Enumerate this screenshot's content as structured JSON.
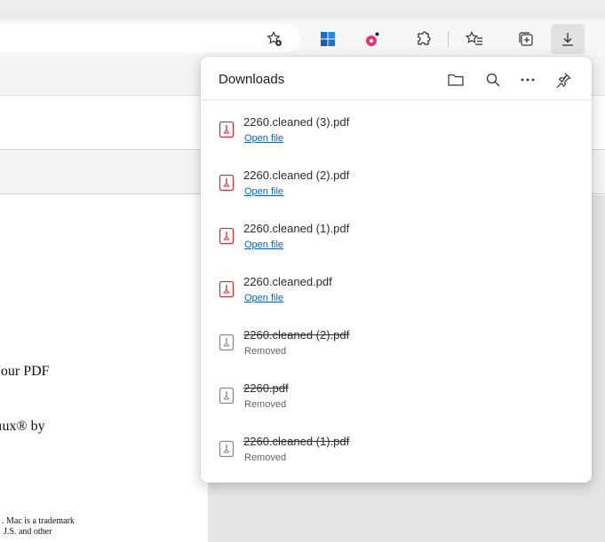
{
  "downloads_panel": {
    "title": "Downloads",
    "header_icons": [
      "folder-icon",
      "search-icon",
      "more-icon",
      "pin-icon"
    ],
    "items": [
      {
        "name": "2260.cleaned (3).pdf",
        "action": "Open file",
        "removed": false
      },
      {
        "name": "2260.cleaned (2).pdf",
        "action": "Open file",
        "removed": false
      },
      {
        "name": "2260.cleaned (1).pdf",
        "action": "Open file",
        "removed": false
      },
      {
        "name": "2260.cleaned.pdf",
        "action": "Open file",
        "removed": false
      },
      {
        "name": "2260.cleaned (2).pdf",
        "status": "Removed",
        "removed": true
      },
      {
        "name": "2260.pdf",
        "status": "Removed",
        "removed": true
      },
      {
        "name": "2260.cleaned (1).pdf",
        "status": "Removed",
        "removed": true
      }
    ]
  },
  "toolbar": {
    "icons": [
      "favorite-add-icon",
      "app-tile-icon",
      "extension-color-icon",
      "extensions-icon",
      "favorites-icon",
      "collections-icon",
      "downloads-icon"
    ]
  },
  "pdf_page": {
    "line1": "'our PDF",
    "line2": "ıux® by",
    "line3": ". Mac is a trademark",
    "line4": "J.S. and other"
  },
  "colors": {
    "accent_link": "#0f62b8",
    "pdf_icon_red": "#d13438",
    "removed_icon_gray": "#8a8a8a",
    "tile_blue": "#1f6fc5",
    "extension_pink": "#e8317a"
  }
}
